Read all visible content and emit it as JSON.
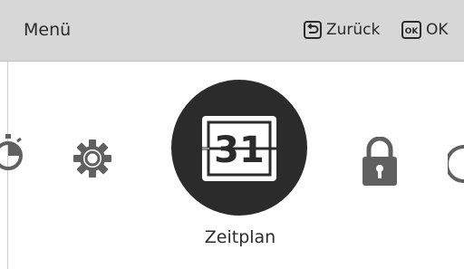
{
  "header": {
    "title": "Menü",
    "back_label": "Zurück",
    "ok_key_glyph": "OK",
    "ok_label": "OK"
  },
  "carousel": {
    "items": [
      {
        "icon": "timer-icon",
        "selected": false
      },
      {
        "icon": "gear-icon",
        "selected": false
      },
      {
        "icon": "calendar-icon",
        "selected": true,
        "day": "31"
      },
      {
        "icon": "lock-icon",
        "selected": false
      },
      {
        "icon": "power-icon",
        "selected": false
      }
    ],
    "selected_label": "Zeitplan"
  },
  "colors": {
    "header_bg": "#d7d7d7",
    "icon_gray": "#606060",
    "selected_circle": "#2b2b2b"
  }
}
